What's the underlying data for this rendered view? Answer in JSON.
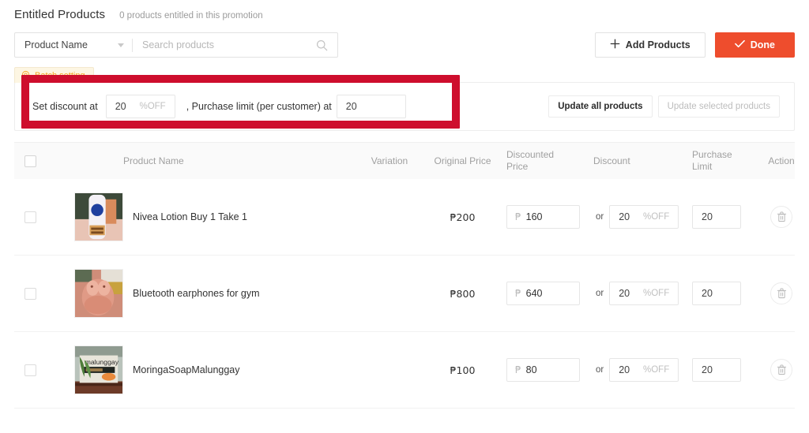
{
  "header": {
    "title": "Entitled Products",
    "count_text": "0 products entitled in this promotion"
  },
  "toolbar": {
    "filter_selected": "Product Name",
    "search_placeholder": "Search products",
    "search_value": "",
    "add_products_label": "Add Products",
    "add_products_icon": "plus-icon",
    "done_label": "Done",
    "done_icon": "check-icon",
    "done_color": "#ee4d2d"
  },
  "batch": {
    "tab_label": "Batch setting",
    "tab_icon": "gear-icon",
    "discount_label": "Set discount at",
    "discount_value": "20",
    "discount_suffix": "%OFF",
    "limit_label": ", Purchase limit (per customer) at",
    "limit_value": "20",
    "update_all_label": "Update all products",
    "update_selected_label": "Update selected products",
    "annotation_color": "#ce0e2d"
  },
  "table": {
    "columns": {
      "product_name": "Product Name",
      "variation": "Variation",
      "original_price": "Original Price",
      "discounted_price_line1": "Discounted",
      "discounted_price_line2": "Price",
      "discount": "Discount",
      "purchase_limit_line1": "Purchase",
      "purchase_limit_line2": "Limit",
      "action": "Action"
    },
    "or_text": "or",
    "percent_suffix": "%OFF",
    "currency_symbol": "₱",
    "delete_icon": "trash-icon",
    "rows": [
      {
        "name": "Nivea Lotion Buy 1 Take 1",
        "variation": "",
        "original_price": "₱200",
        "discounted_price": "160",
        "discount_percent": "20",
        "purchase_limit": "20",
        "thumb": "nivea-lotion-thumbnail"
      },
      {
        "name": "Bluetooth earphones for gym",
        "variation": "",
        "original_price": "₱800",
        "discounted_price": "640",
        "discount_percent": "20",
        "purchase_limit": "20",
        "thumb": "bluetooth-earphones-thumbnail"
      },
      {
        "name": "MoringaSoapMalunggay",
        "variation": "",
        "original_price": "₱100",
        "discounted_price": "80",
        "discount_percent": "20",
        "purchase_limit": "20",
        "thumb": "moringa-soap-thumbnail"
      }
    ]
  }
}
